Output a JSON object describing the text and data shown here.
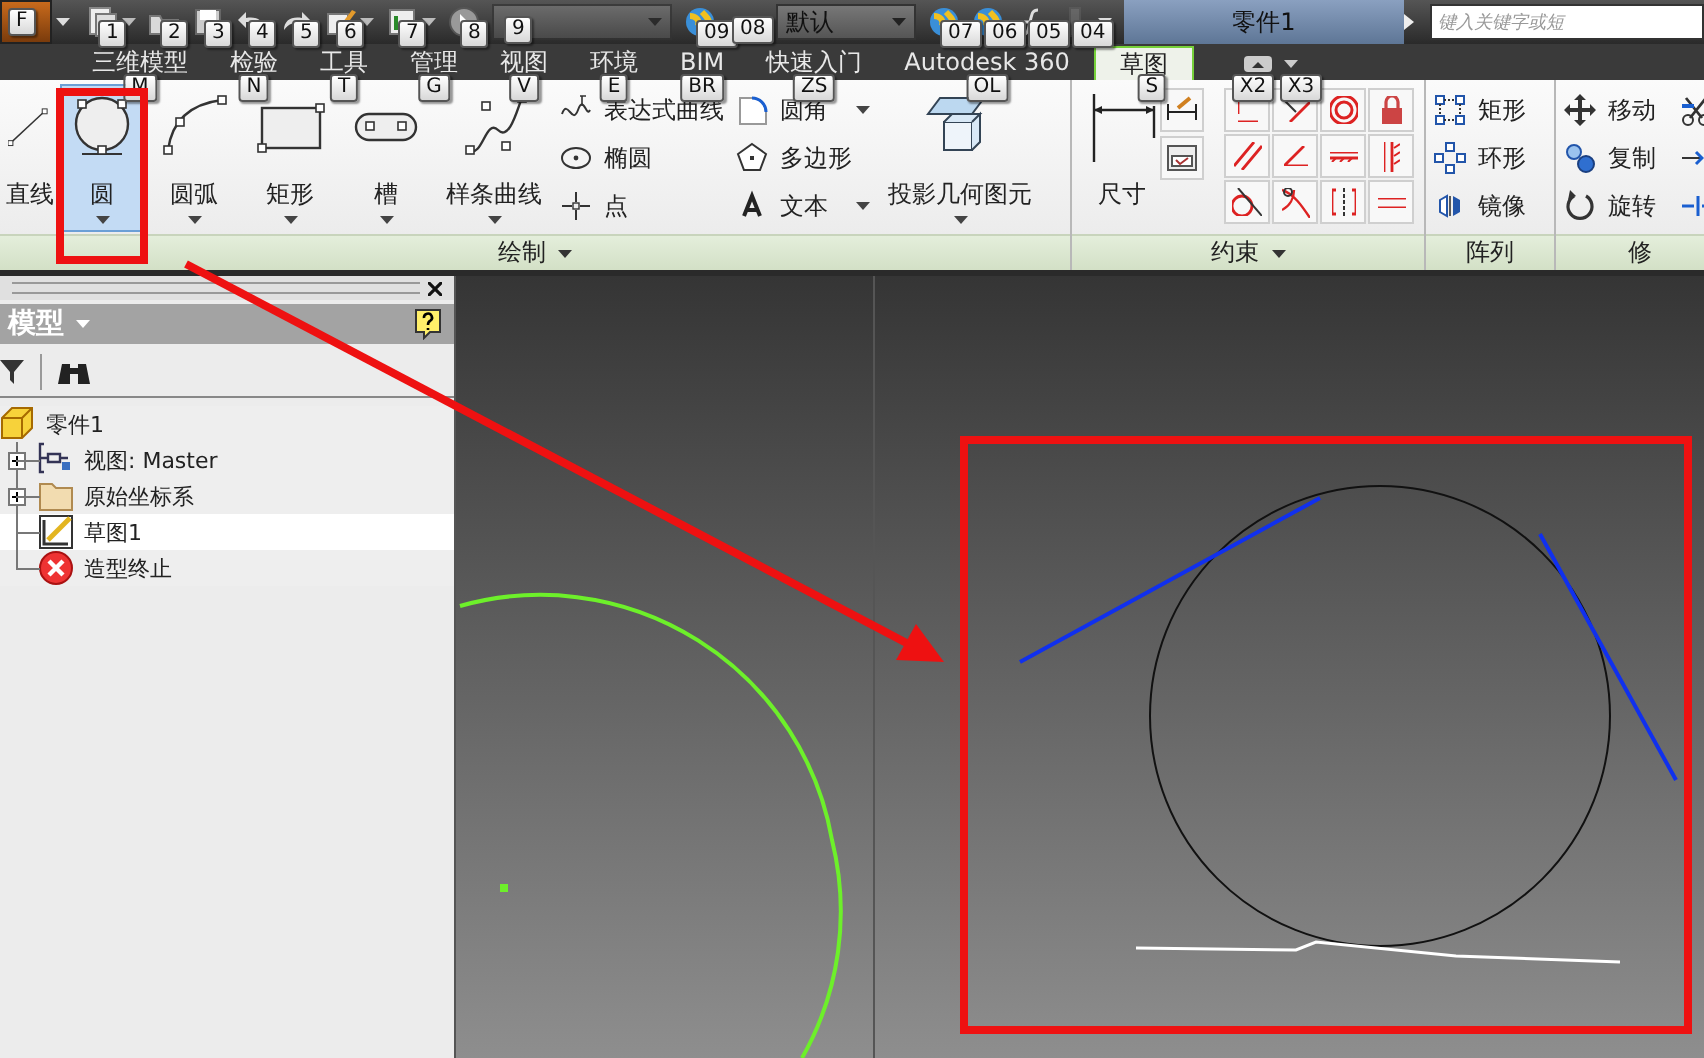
{
  "app_menu": {
    "keytip": "F"
  },
  "quick_access": [
    {
      "kind": "new",
      "keytip": "1",
      "disabled": false
    },
    {
      "kind": "open",
      "keytip": "2",
      "disabled": false
    },
    {
      "kind": "save",
      "keytip": "3",
      "disabled": false
    },
    {
      "kind": "undo",
      "keytip": "4",
      "disabled": false
    },
    {
      "kind": "redo",
      "keytip": "5",
      "disabled": false
    },
    {
      "kind": "edit",
      "keytip": "6",
      "disabled": false
    },
    {
      "kind": "update",
      "keytip": "7",
      "disabled": false
    },
    {
      "kind": "select",
      "keytip": "8",
      "disabled": false
    },
    {
      "kind": "field",
      "keytip": "9",
      "disabled": true
    },
    {
      "kind": "globe",
      "keytip": "09",
      "disabled": false
    },
    {
      "kind": "field",
      "keytip": "08",
      "value": "默认",
      "disabled": false
    },
    {
      "kind": "globe",
      "keytip": "07",
      "disabled": false
    },
    {
      "kind": "globe",
      "keytip": "06",
      "disabled": false
    },
    {
      "kind": "formula",
      "keytip": "05",
      "disabled": false
    },
    {
      "kind": "param",
      "keytip": "04",
      "disabled": true
    }
  ],
  "document_title": "零件1",
  "search": {
    "placeholder": "键入关键字或短"
  },
  "tabs": [
    {
      "label": "三维模型",
      "keytip": "M",
      "selected": false
    },
    {
      "label": "检验",
      "keytip": "N",
      "selected": false
    },
    {
      "label": "工具",
      "keytip": "T",
      "selected": false
    },
    {
      "label": "管理",
      "keytip": "G",
      "selected": false
    },
    {
      "label": "视图",
      "keytip": "V",
      "selected": false
    },
    {
      "label": "环境",
      "keytip": "E",
      "selected": false
    },
    {
      "label": "BIM",
      "keytip": "BR",
      "selected": false
    },
    {
      "label": "快速入门",
      "keytip": "ZS",
      "selected": false
    },
    {
      "label": "Autodesk 360",
      "keytip": "OL",
      "selected": false
    },
    {
      "label": "草图",
      "keytip": "S",
      "selected": true
    }
  ],
  "ribbon_toggle_keytips": [
    "X2",
    "X3"
  ],
  "panels": [
    {
      "title": "绘制",
      "menu": true,
      "buttons": [
        {
          "kind": "large",
          "label": "直线",
          "selected": false,
          "dropdown": false
        },
        {
          "kind": "large",
          "label": "圆",
          "selected": true,
          "dropdown": true
        },
        {
          "kind": "large",
          "label": "圆弧",
          "selected": false,
          "dropdown": true
        },
        {
          "kind": "large",
          "label": "矩形",
          "selected": false,
          "dropdown": true
        },
        {
          "kind": "large",
          "label": "槽",
          "selected": false,
          "dropdown": true
        },
        {
          "kind": "large",
          "label": "样条曲线",
          "selected": false,
          "dropdown": true
        },
        {
          "kind": "small",
          "label": "表达式曲线",
          "dropdown": false
        },
        {
          "kind": "small",
          "label": "椭圆",
          "dropdown": false
        },
        {
          "kind": "small",
          "label": "点",
          "dropdown": false
        },
        {
          "kind": "small",
          "label": "圆角",
          "dropdown": true
        },
        {
          "kind": "small",
          "label": "多边形",
          "dropdown": false
        },
        {
          "kind": "small",
          "label": "文本",
          "dropdown": true
        },
        {
          "kind": "large",
          "label": "投影几何图元",
          "selected": false,
          "dropdown": true
        }
      ]
    },
    {
      "title": "约束",
      "menu": true,
      "buttons": [
        {
          "kind": "large",
          "label": "尺寸",
          "selected": false,
          "dropdown": false
        },
        {
          "kind": "dimension-tools"
        },
        {
          "kind": "constraint-grid"
        }
      ]
    },
    {
      "title": "阵列",
      "menu": false,
      "buttons": [
        {
          "kind": "small",
          "label": "矩形",
          "dropdown": false
        },
        {
          "kind": "small",
          "label": "环形",
          "dropdown": false
        },
        {
          "kind": "small",
          "label": "镜像",
          "dropdown": false
        }
      ]
    },
    {
      "title": "修",
      "menu": false,
      "buttons": [
        {
          "kind": "small",
          "label": "移动",
          "dropdown": false
        },
        {
          "kind": "small",
          "label": "复制",
          "dropdown": false
        },
        {
          "kind": "small",
          "label": "旋转",
          "dropdown": false
        },
        {
          "kind": "trim-tools"
        }
      ]
    }
  ],
  "browser": {
    "title": "模型",
    "tree": {
      "label": "零件1",
      "kind": "part",
      "selected": false,
      "children": [
        {
          "label": "视图: Master",
          "kind": "view",
          "expandable": true,
          "selected": false
        },
        {
          "label": "原始坐标系",
          "kind": "folder",
          "expandable": true,
          "selected": false
        },
        {
          "label": "草图1",
          "kind": "sketch",
          "expandable": false,
          "selected": true
        },
        {
          "label": "造型终止",
          "kind": "end",
          "expandable": false,
          "selected": false
        }
      ]
    }
  }
}
